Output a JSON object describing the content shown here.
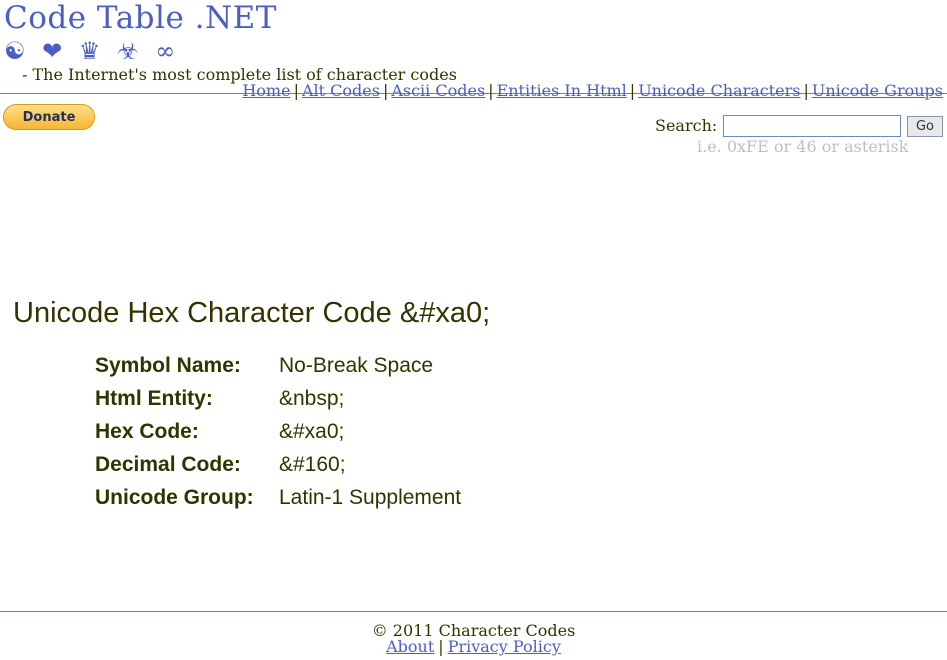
{
  "header": {
    "site_title": "Code Table .NET",
    "symbols": [
      "☯",
      "❤",
      "♛",
      "☣",
      "∞"
    ],
    "tagline": "- The Internet's most complete list of character codes",
    "nav": [
      {
        "label": "Home"
      },
      {
        "label": "Alt Codes"
      },
      {
        "label": "Ascii Codes"
      },
      {
        "label": "Entities In Html"
      },
      {
        "label": "Unicode Characters"
      },
      {
        "label": "Unicode Groups"
      }
    ],
    "nav_separator": "|"
  },
  "donate": {
    "label": "Donate"
  },
  "search": {
    "label": "Search:",
    "value": "",
    "button_label": "Go",
    "hint": "i.e. 0xFE or 46 or asterisk"
  },
  "main": {
    "heading": "Unicode Hex Character Code &#xa0;",
    "rows": [
      {
        "key": "Symbol Name:",
        "value": "No-Break Space"
      },
      {
        "key": "Html Entity:",
        "value": "&nbsp;"
      },
      {
        "key": "Hex Code:",
        "value": "&#xa0;"
      },
      {
        "key": "Decimal Code:",
        "value": "&#160;"
      },
      {
        "key": "Unicode Group:",
        "value": "Latin-1 Supplement"
      }
    ]
  },
  "footer": {
    "copyright": "© 2011 Character Codes",
    "links": [
      {
        "label": "About"
      },
      {
        "label": "Privacy Policy"
      }
    ],
    "separator": "|"
  },
  "colors": {
    "link": "#4a5fc1",
    "text": "#333300",
    "rule": "#8a8a3a",
    "hint": "#c0c0c0"
  }
}
